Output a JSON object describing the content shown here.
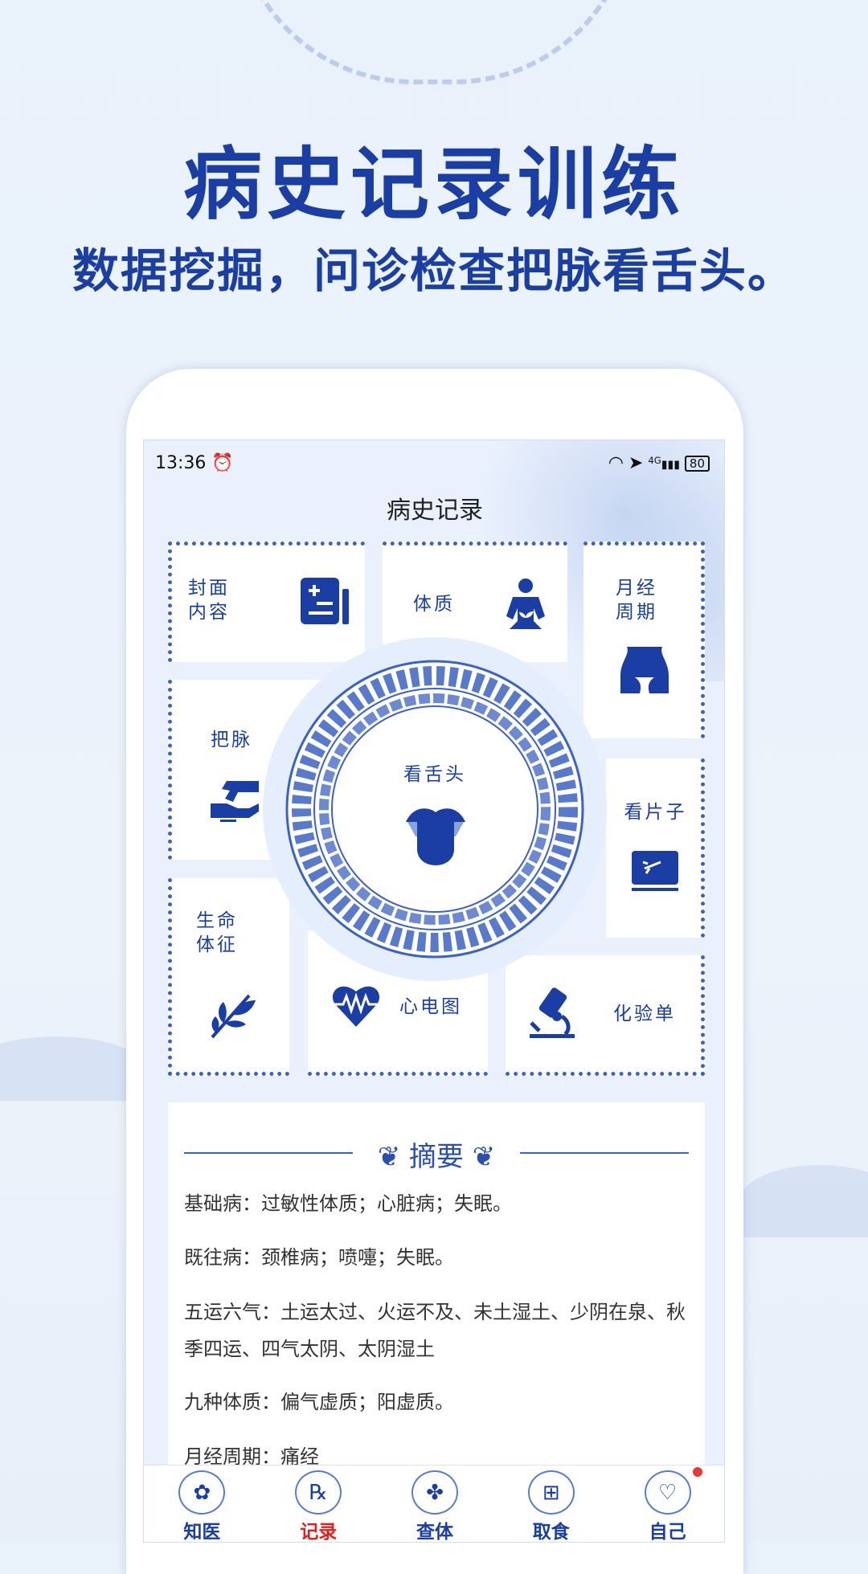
{
  "hero": {
    "title": "病史记录训练",
    "subtitle": "数据挖掘，问诊检查把脉看舌头。"
  },
  "status": {
    "time": "13:36",
    "network": "4G",
    "battery": "80"
  },
  "screen_title": "病史记录",
  "tiles": {
    "cover": "封面\n内容",
    "constitution": "体质",
    "menstrual": "月经\n周期",
    "pulse": "把脉",
    "film": "看片子",
    "vitals": "生命\n体征",
    "ecg": "心电图",
    "lab": "化验单",
    "tongue": "看舌头"
  },
  "summary": {
    "title": "摘要",
    "lines": [
      "基础病：过敏性体质；心脏病；失眠。",
      "既往病：颈椎病；喷嚏；失眠。",
      "五运六气：土运太过、火运不及、未土湿土、少阴在泉、秋季四运、四气太阴、太阴湿土",
      "九种体质：偏气虚质；阳虚质。",
      "月经周期：痛经"
    ]
  },
  "tabs": [
    {
      "label": "知医",
      "icon": "lotus-icon"
    },
    {
      "label": "记录",
      "icon": "prescription-icon",
      "active": true
    },
    {
      "label": "查体",
      "icon": "clover-icon"
    },
    {
      "label": "取食",
      "icon": "food-box-icon"
    },
    {
      "label": "自己",
      "icon": "heart-plus-icon",
      "badge": true
    }
  ],
  "colors": {
    "primary": "#1a3ea3",
    "active_tab": "#e02020",
    "background": "#eaf1fd"
  }
}
